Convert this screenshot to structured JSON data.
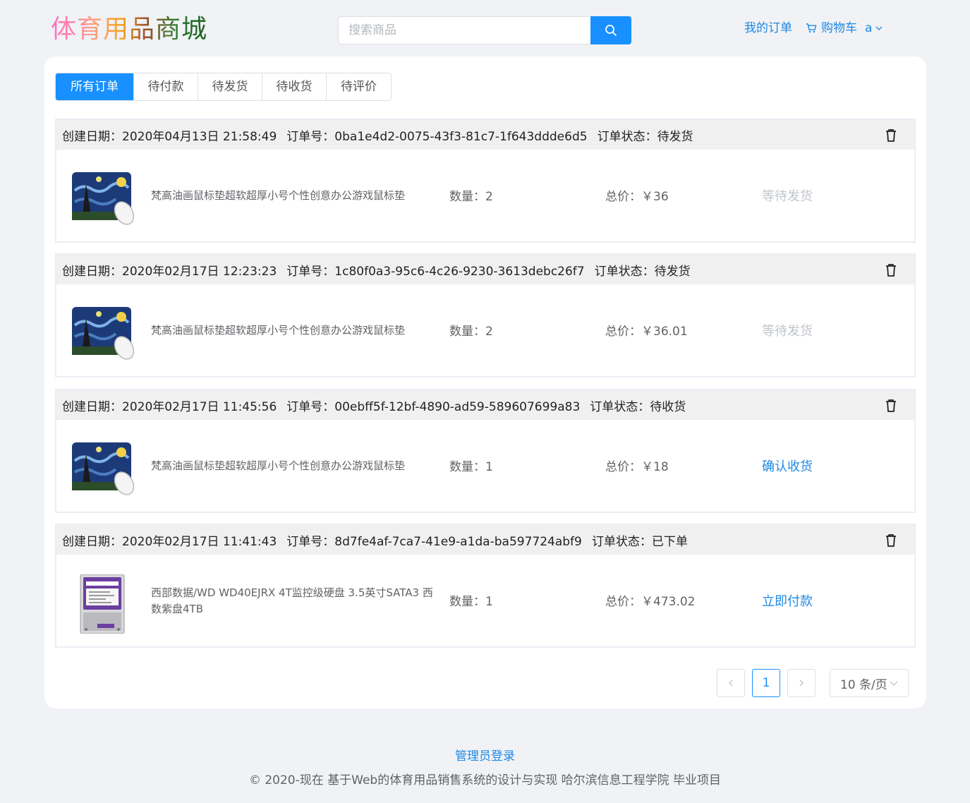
{
  "header": {
    "logo": "体育用品商城",
    "search_placeholder": "搜索商品",
    "my_orders": "我的订单",
    "cart": "购物车",
    "user": "a"
  },
  "tabs": [
    "所有订单",
    "待付款",
    "待发货",
    "待收货",
    "待评价"
  ],
  "active_tab": "所有订单",
  "labels": {
    "created": "创建日期：",
    "order_no": "订单号：",
    "status": "订单状态：",
    "qty": "数量：",
    "total": "总价：",
    "currency": "￥"
  },
  "orders": [
    {
      "created": "2020年04月13日 21:58:49",
      "order_no": "0ba1e4d2-0075-43f3-81c7-1f643ddde6d5",
      "status": "待发货",
      "product": "梵高油画鼠标垫超软超厚小号个性创意办公游戏鼠标垫",
      "image": "starry-night-mousepad",
      "qty": "2",
      "total": "36",
      "action": "等待发货"
    },
    {
      "created": "2020年02月17日 12:23:23",
      "order_no": "1c80f0a3-95c6-4c26-9230-3613debc26f7",
      "status": "待发货",
      "product": "梵高油画鼠标垫超软超厚小号个性创意办公游戏鼠标垫",
      "image": "starry-night-mousepad",
      "qty": "2",
      "total": "36.01",
      "action": "等待发货"
    },
    {
      "created": "2020年02月17日 11:45:56",
      "order_no": "00ebff5f-12bf-4890-ad59-589607699a83",
      "status": "待收货",
      "product": "梵高油画鼠标垫超软超厚小号个性创意办公游戏鼠标垫",
      "image": "starry-night-mousepad",
      "qty": "1",
      "total": "18",
      "action": "确认收货"
    },
    {
      "created": "2020年02月17日 11:41:43",
      "order_no": "8d7fe4af-7ca7-41e9-a1da-ba597724abf9",
      "status": "已下单",
      "product": "西部数据/WD WD40EJRX 4T监控级硬盘 3.5英寸SATA3 西数紫盘4TB",
      "image": "wd-purple-hdd",
      "qty": "1",
      "total": "473.02",
      "action": "立即付款"
    }
  ],
  "pagination": {
    "current_page": "1",
    "page_size": "10 条/页"
  },
  "footer": {
    "admin_login": "管理员登录",
    "copyright": "© 2020-现在 基于Web的体育用品销售系统的设计与实现 哈尔滨信息工程学院 毕业项目"
  },
  "colors": {
    "primary": "#1890ff",
    "link": "#1e88e5",
    "disabled": "#c0c4cc",
    "page_bg": "#f0f2f5"
  }
}
